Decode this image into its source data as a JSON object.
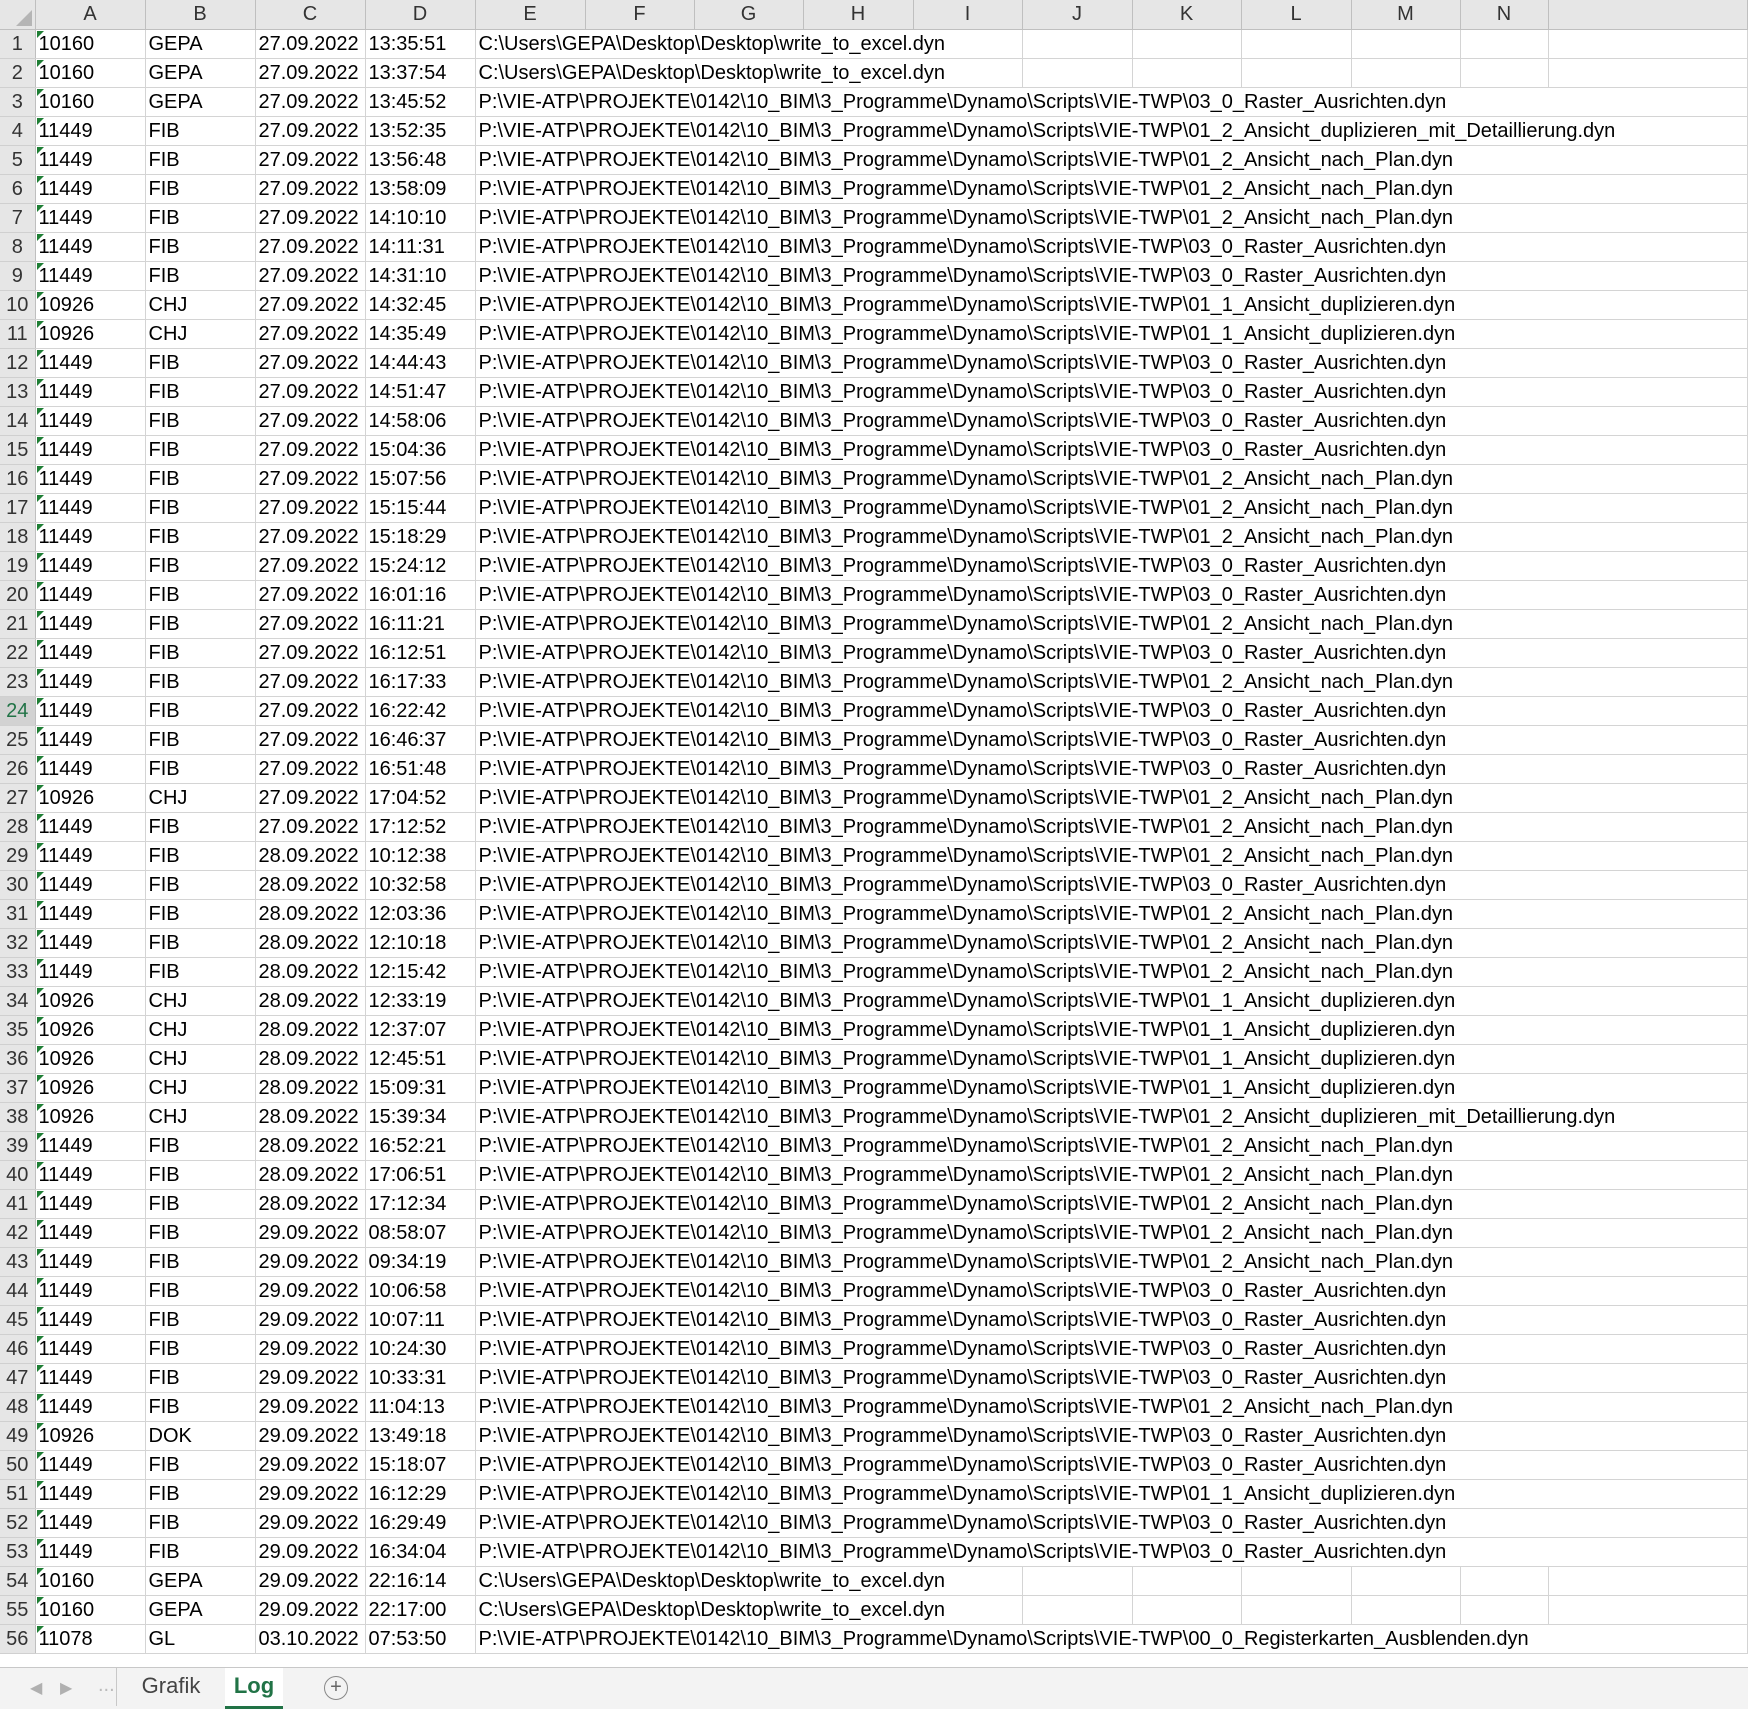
{
  "sheet": {
    "columns": [
      "A",
      "B",
      "C",
      "D",
      "E",
      "F",
      "G",
      "H",
      "I",
      "J",
      "K",
      "L",
      "M",
      "N"
    ],
    "active_row": 24,
    "rows": [
      [
        "1",
        "10160",
        "GEPA",
        "27.09.2022",
        "13:35:51",
        "C:\\Users\\GEPA\\Desktop\\Desktop\\write_to_excel.dyn"
      ],
      [
        "2",
        "10160",
        "GEPA",
        "27.09.2022",
        "13:37:54",
        "C:\\Users\\GEPA\\Desktop\\Desktop\\write_to_excel.dyn"
      ],
      [
        "3",
        "10160",
        "GEPA",
        "27.09.2022",
        "13:45:52",
        "P:\\VIE-ATP\\PROJEKTE\\0142\\10_BIM\\3_Programme\\Dynamo\\Scripts\\VIE-TWP\\03_0_Raster_Ausrichten.dyn"
      ],
      [
        "4",
        "11449",
        "FIB",
        "27.09.2022",
        "13:52:35",
        "P:\\VIE-ATP\\PROJEKTE\\0142\\10_BIM\\3_Programme\\Dynamo\\Scripts\\VIE-TWP\\01_2_Ansicht_duplizieren_mit_Detaillierung.dyn"
      ],
      [
        "5",
        "11449",
        "FIB",
        "27.09.2022",
        "13:56:48",
        "P:\\VIE-ATP\\PROJEKTE\\0142\\10_BIM\\3_Programme\\Dynamo\\Scripts\\VIE-TWP\\01_2_Ansicht_nach_Plan.dyn"
      ],
      [
        "6",
        "11449",
        "FIB",
        "27.09.2022",
        "13:58:09",
        "P:\\VIE-ATP\\PROJEKTE\\0142\\10_BIM\\3_Programme\\Dynamo\\Scripts\\VIE-TWP\\01_2_Ansicht_nach_Plan.dyn"
      ],
      [
        "7",
        "11449",
        "FIB",
        "27.09.2022",
        "14:10:10",
        "P:\\VIE-ATP\\PROJEKTE\\0142\\10_BIM\\3_Programme\\Dynamo\\Scripts\\VIE-TWP\\01_2_Ansicht_nach_Plan.dyn"
      ],
      [
        "8",
        "11449",
        "FIB",
        "27.09.2022",
        "14:11:31",
        "P:\\VIE-ATP\\PROJEKTE\\0142\\10_BIM\\3_Programme\\Dynamo\\Scripts\\VIE-TWP\\03_0_Raster_Ausrichten.dyn"
      ],
      [
        "9",
        "11449",
        "FIB",
        "27.09.2022",
        "14:31:10",
        "P:\\VIE-ATP\\PROJEKTE\\0142\\10_BIM\\3_Programme\\Dynamo\\Scripts\\VIE-TWP\\03_0_Raster_Ausrichten.dyn"
      ],
      [
        "10",
        "10926",
        "CHJ",
        "27.09.2022",
        "14:32:45",
        "P:\\VIE-ATP\\PROJEKTE\\0142\\10_BIM\\3_Programme\\Dynamo\\Scripts\\VIE-TWP\\01_1_Ansicht_duplizieren.dyn"
      ],
      [
        "11",
        "10926",
        "CHJ",
        "27.09.2022",
        "14:35:49",
        "P:\\VIE-ATP\\PROJEKTE\\0142\\10_BIM\\3_Programme\\Dynamo\\Scripts\\VIE-TWP\\01_1_Ansicht_duplizieren.dyn"
      ],
      [
        "12",
        "11449",
        "FIB",
        "27.09.2022",
        "14:44:43",
        "P:\\VIE-ATP\\PROJEKTE\\0142\\10_BIM\\3_Programme\\Dynamo\\Scripts\\VIE-TWP\\03_0_Raster_Ausrichten.dyn"
      ],
      [
        "13",
        "11449",
        "FIB",
        "27.09.2022",
        "14:51:47",
        "P:\\VIE-ATP\\PROJEKTE\\0142\\10_BIM\\3_Programme\\Dynamo\\Scripts\\VIE-TWP\\03_0_Raster_Ausrichten.dyn"
      ],
      [
        "14",
        "11449",
        "FIB",
        "27.09.2022",
        "14:58:06",
        "P:\\VIE-ATP\\PROJEKTE\\0142\\10_BIM\\3_Programme\\Dynamo\\Scripts\\VIE-TWP\\03_0_Raster_Ausrichten.dyn"
      ],
      [
        "15",
        "11449",
        "FIB",
        "27.09.2022",
        "15:04:36",
        "P:\\VIE-ATP\\PROJEKTE\\0142\\10_BIM\\3_Programme\\Dynamo\\Scripts\\VIE-TWP\\03_0_Raster_Ausrichten.dyn"
      ],
      [
        "16",
        "11449",
        "FIB",
        "27.09.2022",
        "15:07:56",
        "P:\\VIE-ATP\\PROJEKTE\\0142\\10_BIM\\3_Programme\\Dynamo\\Scripts\\VIE-TWP\\01_2_Ansicht_nach_Plan.dyn"
      ],
      [
        "17",
        "11449",
        "FIB",
        "27.09.2022",
        "15:15:44",
        "P:\\VIE-ATP\\PROJEKTE\\0142\\10_BIM\\3_Programme\\Dynamo\\Scripts\\VIE-TWP\\01_2_Ansicht_nach_Plan.dyn"
      ],
      [
        "18",
        "11449",
        "FIB",
        "27.09.2022",
        "15:18:29",
        "P:\\VIE-ATP\\PROJEKTE\\0142\\10_BIM\\3_Programme\\Dynamo\\Scripts\\VIE-TWP\\01_2_Ansicht_nach_Plan.dyn"
      ],
      [
        "19",
        "11449",
        "FIB",
        "27.09.2022",
        "15:24:12",
        "P:\\VIE-ATP\\PROJEKTE\\0142\\10_BIM\\3_Programme\\Dynamo\\Scripts\\VIE-TWP\\03_0_Raster_Ausrichten.dyn"
      ],
      [
        "20",
        "11449",
        "FIB",
        "27.09.2022",
        "16:01:16",
        "P:\\VIE-ATP\\PROJEKTE\\0142\\10_BIM\\3_Programme\\Dynamo\\Scripts\\VIE-TWP\\03_0_Raster_Ausrichten.dyn"
      ],
      [
        "21",
        "11449",
        "FIB",
        "27.09.2022",
        "16:11:21",
        "P:\\VIE-ATP\\PROJEKTE\\0142\\10_BIM\\3_Programme\\Dynamo\\Scripts\\VIE-TWP\\01_2_Ansicht_nach_Plan.dyn"
      ],
      [
        "22",
        "11449",
        "FIB",
        "27.09.2022",
        "16:12:51",
        "P:\\VIE-ATP\\PROJEKTE\\0142\\10_BIM\\3_Programme\\Dynamo\\Scripts\\VIE-TWP\\03_0_Raster_Ausrichten.dyn"
      ],
      [
        "23",
        "11449",
        "FIB",
        "27.09.2022",
        "16:17:33",
        "P:\\VIE-ATP\\PROJEKTE\\0142\\10_BIM\\3_Programme\\Dynamo\\Scripts\\VIE-TWP\\01_2_Ansicht_nach_Plan.dyn"
      ],
      [
        "24",
        "11449",
        "FIB",
        "27.09.2022",
        "16:22:42",
        "P:\\VIE-ATP\\PROJEKTE\\0142\\10_BIM\\3_Programme\\Dynamo\\Scripts\\VIE-TWP\\03_0_Raster_Ausrichten.dyn"
      ],
      [
        "25",
        "11449",
        "FIB",
        "27.09.2022",
        "16:46:37",
        "P:\\VIE-ATP\\PROJEKTE\\0142\\10_BIM\\3_Programme\\Dynamo\\Scripts\\VIE-TWP\\03_0_Raster_Ausrichten.dyn"
      ],
      [
        "26",
        "11449",
        "FIB",
        "27.09.2022",
        "16:51:48",
        "P:\\VIE-ATP\\PROJEKTE\\0142\\10_BIM\\3_Programme\\Dynamo\\Scripts\\VIE-TWP\\03_0_Raster_Ausrichten.dyn"
      ],
      [
        "27",
        "10926",
        "CHJ",
        "27.09.2022",
        "17:04:52",
        "P:\\VIE-ATP\\PROJEKTE\\0142\\10_BIM\\3_Programme\\Dynamo\\Scripts\\VIE-TWP\\01_2_Ansicht_nach_Plan.dyn"
      ],
      [
        "28",
        "11449",
        "FIB",
        "27.09.2022",
        "17:12:52",
        "P:\\VIE-ATP\\PROJEKTE\\0142\\10_BIM\\3_Programme\\Dynamo\\Scripts\\VIE-TWP\\01_2_Ansicht_nach_Plan.dyn"
      ],
      [
        "29",
        "11449",
        "FIB",
        "28.09.2022",
        "10:12:38",
        "P:\\VIE-ATP\\PROJEKTE\\0142\\10_BIM\\3_Programme\\Dynamo\\Scripts\\VIE-TWP\\01_2_Ansicht_nach_Plan.dyn"
      ],
      [
        "30",
        "11449",
        "FIB",
        "28.09.2022",
        "10:32:58",
        "P:\\VIE-ATP\\PROJEKTE\\0142\\10_BIM\\3_Programme\\Dynamo\\Scripts\\VIE-TWP\\03_0_Raster_Ausrichten.dyn"
      ],
      [
        "31",
        "11449",
        "FIB",
        "28.09.2022",
        "12:03:36",
        "P:\\VIE-ATP\\PROJEKTE\\0142\\10_BIM\\3_Programme\\Dynamo\\Scripts\\VIE-TWP\\01_2_Ansicht_nach_Plan.dyn"
      ],
      [
        "32",
        "11449",
        "FIB",
        "28.09.2022",
        "12:10:18",
        "P:\\VIE-ATP\\PROJEKTE\\0142\\10_BIM\\3_Programme\\Dynamo\\Scripts\\VIE-TWP\\01_2_Ansicht_nach_Plan.dyn"
      ],
      [
        "33",
        "11449",
        "FIB",
        "28.09.2022",
        "12:15:42",
        "P:\\VIE-ATP\\PROJEKTE\\0142\\10_BIM\\3_Programme\\Dynamo\\Scripts\\VIE-TWP\\01_2_Ansicht_nach_Plan.dyn"
      ],
      [
        "34",
        "10926",
        "CHJ",
        "28.09.2022",
        "12:33:19",
        "P:\\VIE-ATP\\PROJEKTE\\0142\\10_BIM\\3_Programme\\Dynamo\\Scripts\\VIE-TWP\\01_1_Ansicht_duplizieren.dyn"
      ],
      [
        "35",
        "10926",
        "CHJ",
        "28.09.2022",
        "12:37:07",
        "P:\\VIE-ATP\\PROJEKTE\\0142\\10_BIM\\3_Programme\\Dynamo\\Scripts\\VIE-TWP\\01_1_Ansicht_duplizieren.dyn"
      ],
      [
        "36",
        "10926",
        "CHJ",
        "28.09.2022",
        "12:45:51",
        "P:\\VIE-ATP\\PROJEKTE\\0142\\10_BIM\\3_Programme\\Dynamo\\Scripts\\VIE-TWP\\01_1_Ansicht_duplizieren.dyn"
      ],
      [
        "37",
        "10926",
        "CHJ",
        "28.09.2022",
        "15:09:31",
        "P:\\VIE-ATP\\PROJEKTE\\0142\\10_BIM\\3_Programme\\Dynamo\\Scripts\\VIE-TWP\\01_1_Ansicht_duplizieren.dyn"
      ],
      [
        "38",
        "10926",
        "CHJ",
        "28.09.2022",
        "15:39:34",
        "P:\\VIE-ATP\\PROJEKTE\\0142\\10_BIM\\3_Programme\\Dynamo\\Scripts\\VIE-TWP\\01_2_Ansicht_duplizieren_mit_Detaillierung.dyn"
      ],
      [
        "39",
        "11449",
        "FIB",
        "28.09.2022",
        "16:52:21",
        "P:\\VIE-ATP\\PROJEKTE\\0142\\10_BIM\\3_Programme\\Dynamo\\Scripts\\VIE-TWP\\01_2_Ansicht_nach_Plan.dyn"
      ],
      [
        "40",
        "11449",
        "FIB",
        "28.09.2022",
        "17:06:51",
        "P:\\VIE-ATP\\PROJEKTE\\0142\\10_BIM\\3_Programme\\Dynamo\\Scripts\\VIE-TWP\\01_2_Ansicht_nach_Plan.dyn"
      ],
      [
        "41",
        "11449",
        "FIB",
        "28.09.2022",
        "17:12:34",
        "P:\\VIE-ATP\\PROJEKTE\\0142\\10_BIM\\3_Programme\\Dynamo\\Scripts\\VIE-TWP\\01_2_Ansicht_nach_Plan.dyn"
      ],
      [
        "42",
        "11449",
        "FIB",
        "29.09.2022",
        "08:58:07",
        "P:\\VIE-ATP\\PROJEKTE\\0142\\10_BIM\\3_Programme\\Dynamo\\Scripts\\VIE-TWP\\01_2_Ansicht_nach_Plan.dyn"
      ],
      [
        "43",
        "11449",
        "FIB",
        "29.09.2022",
        "09:34:19",
        "P:\\VIE-ATP\\PROJEKTE\\0142\\10_BIM\\3_Programme\\Dynamo\\Scripts\\VIE-TWP\\01_2_Ansicht_nach_Plan.dyn"
      ],
      [
        "44",
        "11449",
        "FIB",
        "29.09.2022",
        "10:06:58",
        "P:\\VIE-ATP\\PROJEKTE\\0142\\10_BIM\\3_Programme\\Dynamo\\Scripts\\VIE-TWP\\03_0_Raster_Ausrichten.dyn"
      ],
      [
        "45",
        "11449",
        "FIB",
        "29.09.2022",
        "10:07:11",
        "P:\\VIE-ATP\\PROJEKTE\\0142\\10_BIM\\3_Programme\\Dynamo\\Scripts\\VIE-TWP\\03_0_Raster_Ausrichten.dyn"
      ],
      [
        "46",
        "11449",
        "FIB",
        "29.09.2022",
        "10:24:30",
        "P:\\VIE-ATP\\PROJEKTE\\0142\\10_BIM\\3_Programme\\Dynamo\\Scripts\\VIE-TWP\\03_0_Raster_Ausrichten.dyn"
      ],
      [
        "47",
        "11449",
        "FIB",
        "29.09.2022",
        "10:33:31",
        "P:\\VIE-ATP\\PROJEKTE\\0142\\10_BIM\\3_Programme\\Dynamo\\Scripts\\VIE-TWP\\03_0_Raster_Ausrichten.dyn"
      ],
      [
        "48",
        "11449",
        "FIB",
        "29.09.2022",
        "11:04:13",
        "P:\\VIE-ATP\\PROJEKTE\\0142\\10_BIM\\3_Programme\\Dynamo\\Scripts\\VIE-TWP\\01_2_Ansicht_nach_Plan.dyn"
      ],
      [
        "49",
        "10926",
        "DOK",
        "29.09.2022",
        "13:49:18",
        "P:\\VIE-ATP\\PROJEKTE\\0142\\10_BIM\\3_Programme\\Dynamo\\Scripts\\VIE-TWP\\03_0_Raster_Ausrichten.dyn"
      ],
      [
        "50",
        "11449",
        "FIB",
        "29.09.2022",
        "15:18:07",
        "P:\\VIE-ATP\\PROJEKTE\\0142\\10_BIM\\3_Programme\\Dynamo\\Scripts\\VIE-TWP\\03_0_Raster_Ausrichten.dyn"
      ],
      [
        "51",
        "11449",
        "FIB",
        "29.09.2022",
        "16:12:29",
        "P:\\VIE-ATP\\PROJEKTE\\0142\\10_BIM\\3_Programme\\Dynamo\\Scripts\\VIE-TWP\\01_1_Ansicht_duplizieren.dyn"
      ],
      [
        "52",
        "11449",
        "FIB",
        "29.09.2022",
        "16:29:49",
        "P:\\VIE-ATP\\PROJEKTE\\0142\\10_BIM\\3_Programme\\Dynamo\\Scripts\\VIE-TWP\\03_0_Raster_Ausrichten.dyn"
      ],
      [
        "53",
        "11449",
        "FIB",
        "29.09.2022",
        "16:34:04",
        "P:\\VIE-ATP\\PROJEKTE\\0142\\10_BIM\\3_Programme\\Dynamo\\Scripts\\VIE-TWP\\03_0_Raster_Ausrichten.dyn"
      ],
      [
        "54",
        "10160",
        "GEPA",
        "29.09.2022",
        "22:16:14",
        "C:\\Users\\GEPA\\Desktop\\Desktop\\write_to_excel.dyn"
      ],
      [
        "55",
        "10160",
        "GEPA",
        "29.09.2022",
        "22:17:00",
        "C:\\Users\\GEPA\\Desktop\\Desktop\\write_to_excel.dyn"
      ],
      [
        "56",
        "11078",
        "GL",
        "03.10.2022",
        "07:53:50",
        "P:\\VIE-ATP\\PROJEKTE\\0142\\10_BIM\\3_Programme\\Dynamo\\Scripts\\VIE-TWP\\00_0_Registerkarten_Ausblenden.dyn"
      ]
    ]
  },
  "tabs": {
    "prev_icon": "chevron-left-icon",
    "next_icon": "chevron-right-icon",
    "dots": "...",
    "items": [
      {
        "label": "Grafik",
        "active": false
      },
      {
        "label": "Log",
        "active": true
      }
    ],
    "add_label": "+"
  },
  "colors": {
    "accent": "#217346",
    "header_bg": "#e6e6e6",
    "gridline": "#d4d4d4"
  }
}
